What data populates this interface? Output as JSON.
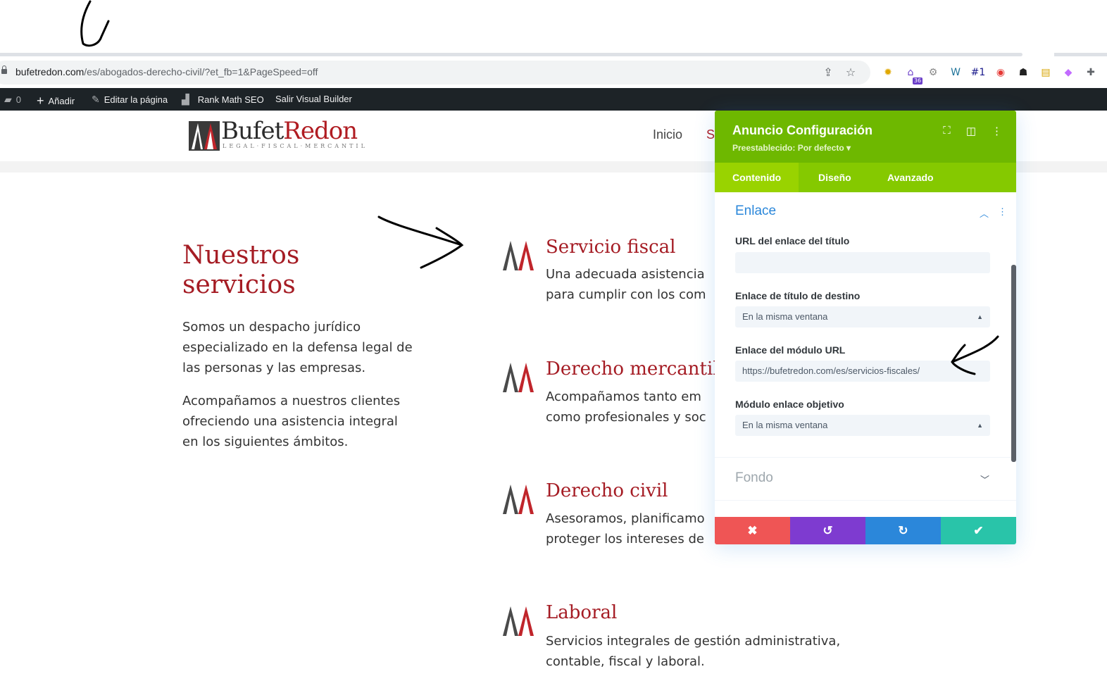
{
  "browser": {
    "url_domain": "bufetredon.com",
    "url_path": "/es/abogados-derecho-civil/?et_fb=1&PageSpeed=off",
    "omnibox_icons": [
      "share-icon",
      "star-icon"
    ],
    "extensions": [
      {
        "name": "ext-sun-icon",
        "glyph": "✹",
        "color": "#e0a800"
      },
      {
        "name": "ext-school-icon",
        "glyph": "⌂",
        "color": "#6b3fc9",
        "badge": "36"
      },
      {
        "name": "ext-gear-icon",
        "glyph": "⚙",
        "color": "#888888"
      },
      {
        "name": "ext-wordpress-icon",
        "glyph": "W",
        "color": "#21759b"
      },
      {
        "name": "ext-rank1-icon",
        "glyph": "#1",
        "color": "#1a1a8c"
      },
      {
        "name": "ext-pin-icon",
        "glyph": "◉",
        "color": "#e53935"
      },
      {
        "name": "ext-spy-icon",
        "glyph": "☗",
        "color": "#222222"
      },
      {
        "name": "ext-ruler-icon",
        "glyph": "▤",
        "color": "#d6a400"
      },
      {
        "name": "ext-gradient-icon",
        "glyph": "◆",
        "color": "#c26bff"
      },
      {
        "name": "extensions-puzzle-icon",
        "glyph": "✚",
        "color": "#5f6368"
      }
    ]
  },
  "adminbar": {
    "comments_count": "0",
    "add_label": "Añadir",
    "edit_label": "Editar la página",
    "rankmath_label": "Rank Math SEO",
    "exit_label": "Salir Visual Builder"
  },
  "site": {
    "logo_part1": "Bufet",
    "logo_part2": "Redon",
    "logo_tagline": "LEGAL·FISCAL·MERCANTIL",
    "nav_inicio": "Inicio",
    "nav_partial": "S"
  },
  "content": {
    "heading": "Nuestros servicios",
    "intro_1": "Somos un despacho jurídico especializado en la defensa legal de las personas y las empresas.",
    "intro_2": "Acompañamos a nuestros clientes ofreciendo una asistencia integral en los siguientes ámbitos.",
    "services": [
      {
        "title": "Servicio fiscal",
        "text": "Una adecuada asistencia\npara cumplir con los com"
      },
      {
        "title": "Derecho mercantil",
        "text": "Acompañamos tanto em\ncomo profesionales y soc"
      },
      {
        "title": "Derecho civil",
        "text": "Asesoramos, planificamo\nproteger los intereses de"
      },
      {
        "title": "Laboral",
        "text": "Servicios integrales de gestión administrativa,\ncontable, fiscal y laboral."
      }
    ]
  },
  "panel": {
    "title": "Anuncio Configuración",
    "preset": "Preestablecido: Por defecto ▾",
    "tabs": [
      "Contenido",
      "Diseño",
      "Avanzado"
    ],
    "section_open": "Enlace",
    "fields": [
      {
        "label": "URL del enlace del título",
        "value": ""
      },
      {
        "label": "Enlace de título de destino",
        "value": "En la misma ventana"
      },
      {
        "label": "Enlace del módulo URL",
        "value": "https://bufetredon.com/es/servicios-fiscales/"
      },
      {
        "label": "Módulo enlace objetivo",
        "value": "En la misma ventana"
      }
    ],
    "section_closed": "Fondo",
    "footer_colors": [
      "#ef5555",
      "#7e3bd0",
      "#2b87da",
      "#29c4a9"
    ]
  },
  "colors": {
    "brand_red": "#a51c24",
    "divi_green": "#6eb800",
    "wp_bar": "#1d2327"
  }
}
